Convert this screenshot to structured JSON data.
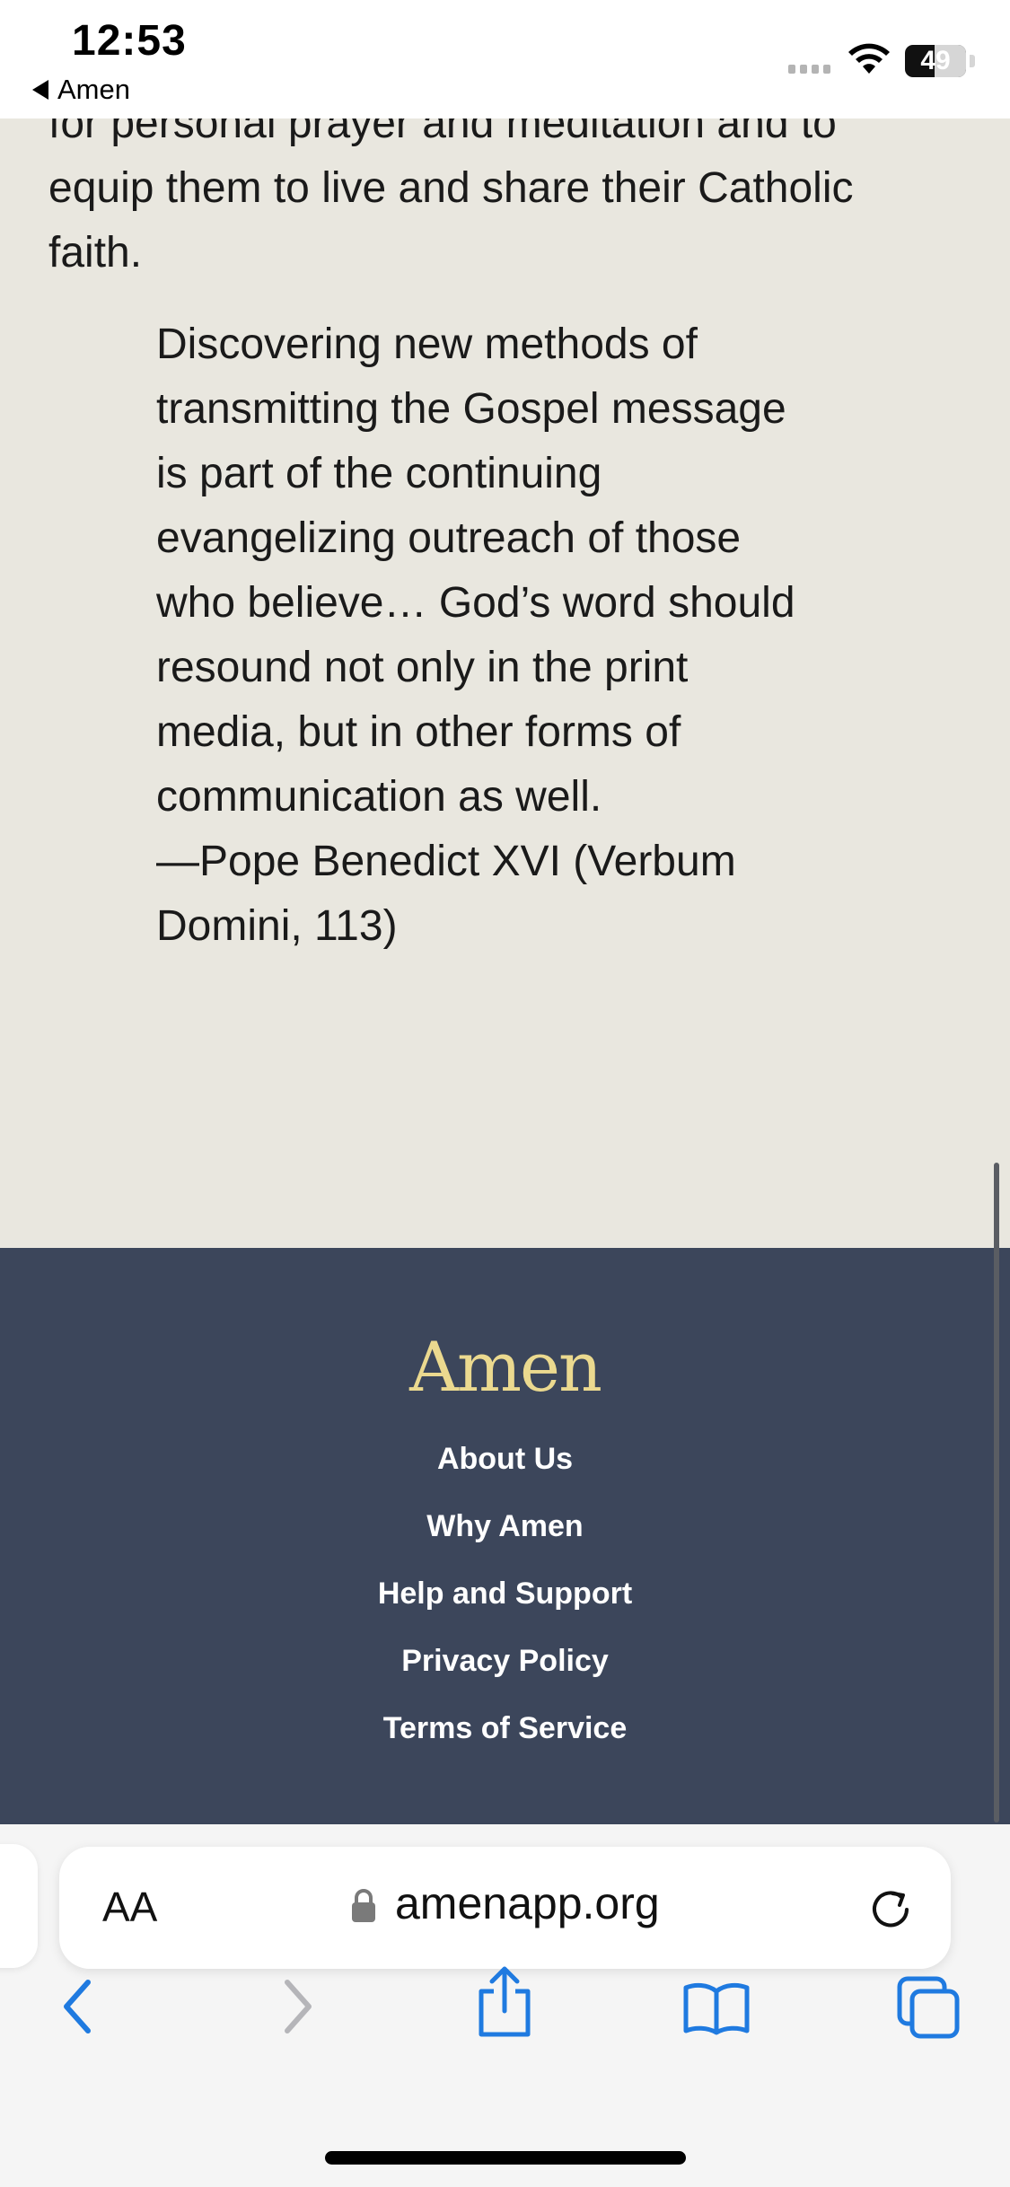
{
  "status_bar": {
    "time": "12:53",
    "back_app_label": "Amen",
    "battery_percent": "49",
    "battery_level": 0.49
  },
  "article": {
    "clipped_paragraph_lines": [
      "for personal prayer and meditation and to",
      "equip them to live and share their Catholic",
      "faith."
    ],
    "quote_lines": [
      "Discovering new methods of",
      "transmitting the Gospel message",
      "is part of the continuing",
      "evangelizing outreach of those",
      "who believe… God’s word should",
      "resound not only in the print",
      "media, but in other forms of",
      "communication as well.",
      "—Pope Benedict XVI (Verbum",
      "Domini, 113)"
    ]
  },
  "footer": {
    "logo_text": "Amen",
    "links": [
      "About Us",
      "Why Amen",
      "Help and Support",
      "Privacy Policy",
      "Terms of Service"
    ]
  },
  "browser": {
    "text_size_label": "AA",
    "url": "amenapp.org"
  },
  "icons": {
    "back": "chevron-left-icon",
    "forward": "chevron-right-icon",
    "share": "share-icon",
    "bookmarks": "book-icon",
    "tabs": "tabs-icon",
    "lock": "lock-icon",
    "reload": "reload-icon",
    "wifi": "wifi-icon",
    "battery": "battery-icon"
  },
  "colors": {
    "page_background": "#e9e7df",
    "footer_background": "#3c465b",
    "logo_gold": "#ebd98f",
    "link_blue": "#1f7ae0"
  }
}
